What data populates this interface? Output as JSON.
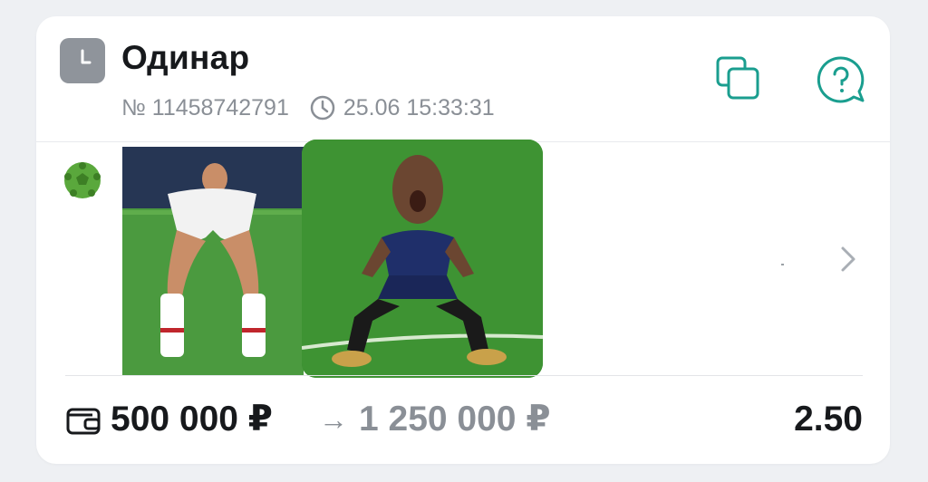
{
  "bet": {
    "type_label": "Одинар",
    "number": "№ 11458742791",
    "datetime": "25.06 15:33:31",
    "stake": "500 000 ₽",
    "arrow": "→",
    "payout": "1 250 000 ₽",
    "odds": "2.50"
  },
  "icons": {
    "type": "clock-icon",
    "copy": "copy-icon",
    "help": "help-chat-icon",
    "sport": "soccer-ball-icon",
    "chevron": "chevron-right-icon",
    "wallet": "wallet-icon"
  },
  "colors": {
    "accent": "#1a9e8f",
    "sport_green": "#5aa83c",
    "text_primary": "#17191c",
    "text_secondary": "#8a8f96"
  }
}
